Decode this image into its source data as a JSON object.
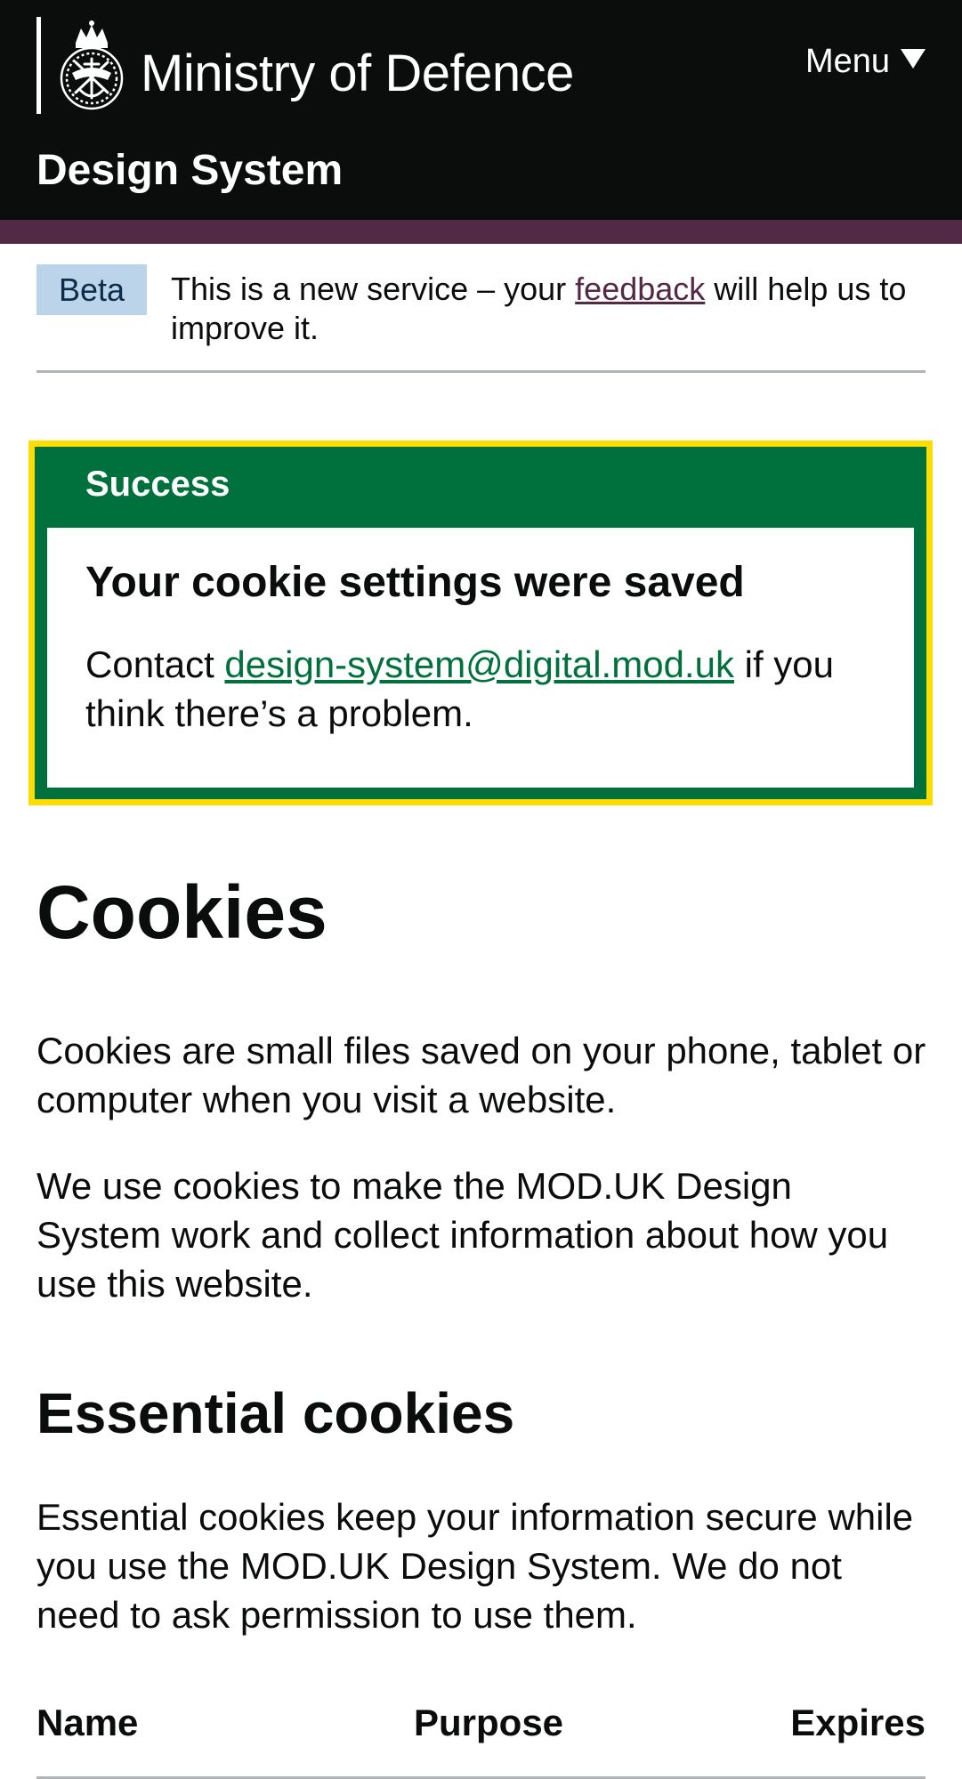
{
  "header": {
    "organisation": "Ministry of Defence",
    "menu_label": "Menu",
    "service_name": "Design System",
    "colors": {
      "background": "#0b0c0c",
      "accent_bar": "#532a45"
    }
  },
  "phase_banner": {
    "tag": "Beta",
    "text_before": "This is a new service – your ",
    "link_text": "feedback",
    "text_after": " will help us to improve it."
  },
  "notification": {
    "title": "Success",
    "heading": "Your cookie settings were saved",
    "text_before": "Contact ",
    "email_link": "design-system@digital.mod.uk",
    "text_after": " if you think there’s a problem.",
    "colors": {
      "success": "#00703c",
      "focus": "#ffdd00"
    }
  },
  "main": {
    "title": "Cookies",
    "intro_paragraph_1": "Cookies are small files saved on your phone, tablet or computer when you visit a website.",
    "intro_paragraph_2": "We use cookies to make the MOD.UK Design System work and collect information about how you use this website.",
    "essential_heading": "Essential cookies",
    "essential_paragraph": "Essential cookies keep your information secure while you use the MOD.UK Design System. We do not need to ask permission to use them.",
    "table": {
      "headers": [
        "Name",
        "Purpose",
        "Expires"
      ]
    }
  }
}
